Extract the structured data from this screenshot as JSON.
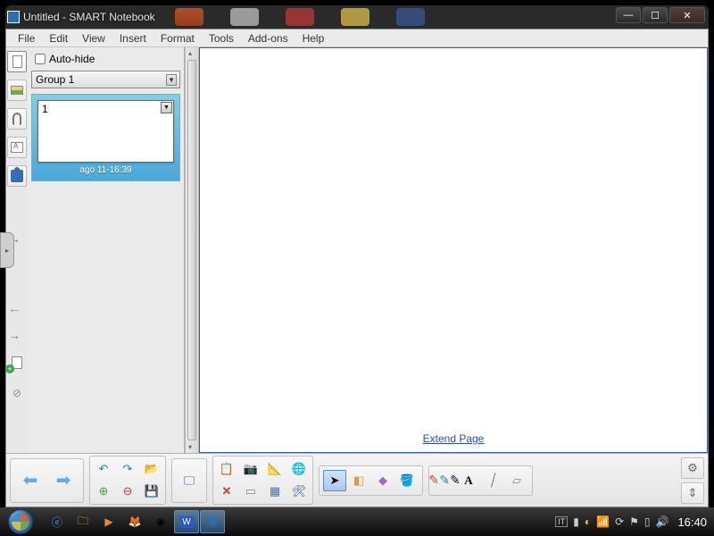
{
  "window": {
    "title": "Untitled - SMART Notebook"
  },
  "menu": {
    "file": "File",
    "edit": "Edit",
    "view": "View",
    "insert": "Insert",
    "format": "Format",
    "tools": "Tools",
    "addons": "Add-ons",
    "help": "Help"
  },
  "pagepanel": {
    "autohide_label": "Auto-hide",
    "group_label": "Group 1",
    "thumb": {
      "num": "1",
      "timestamp": "ago 11-16:39"
    }
  },
  "canvas": {
    "extend_link": "Extend Page"
  },
  "taskbar": {
    "clock": "16:40"
  }
}
